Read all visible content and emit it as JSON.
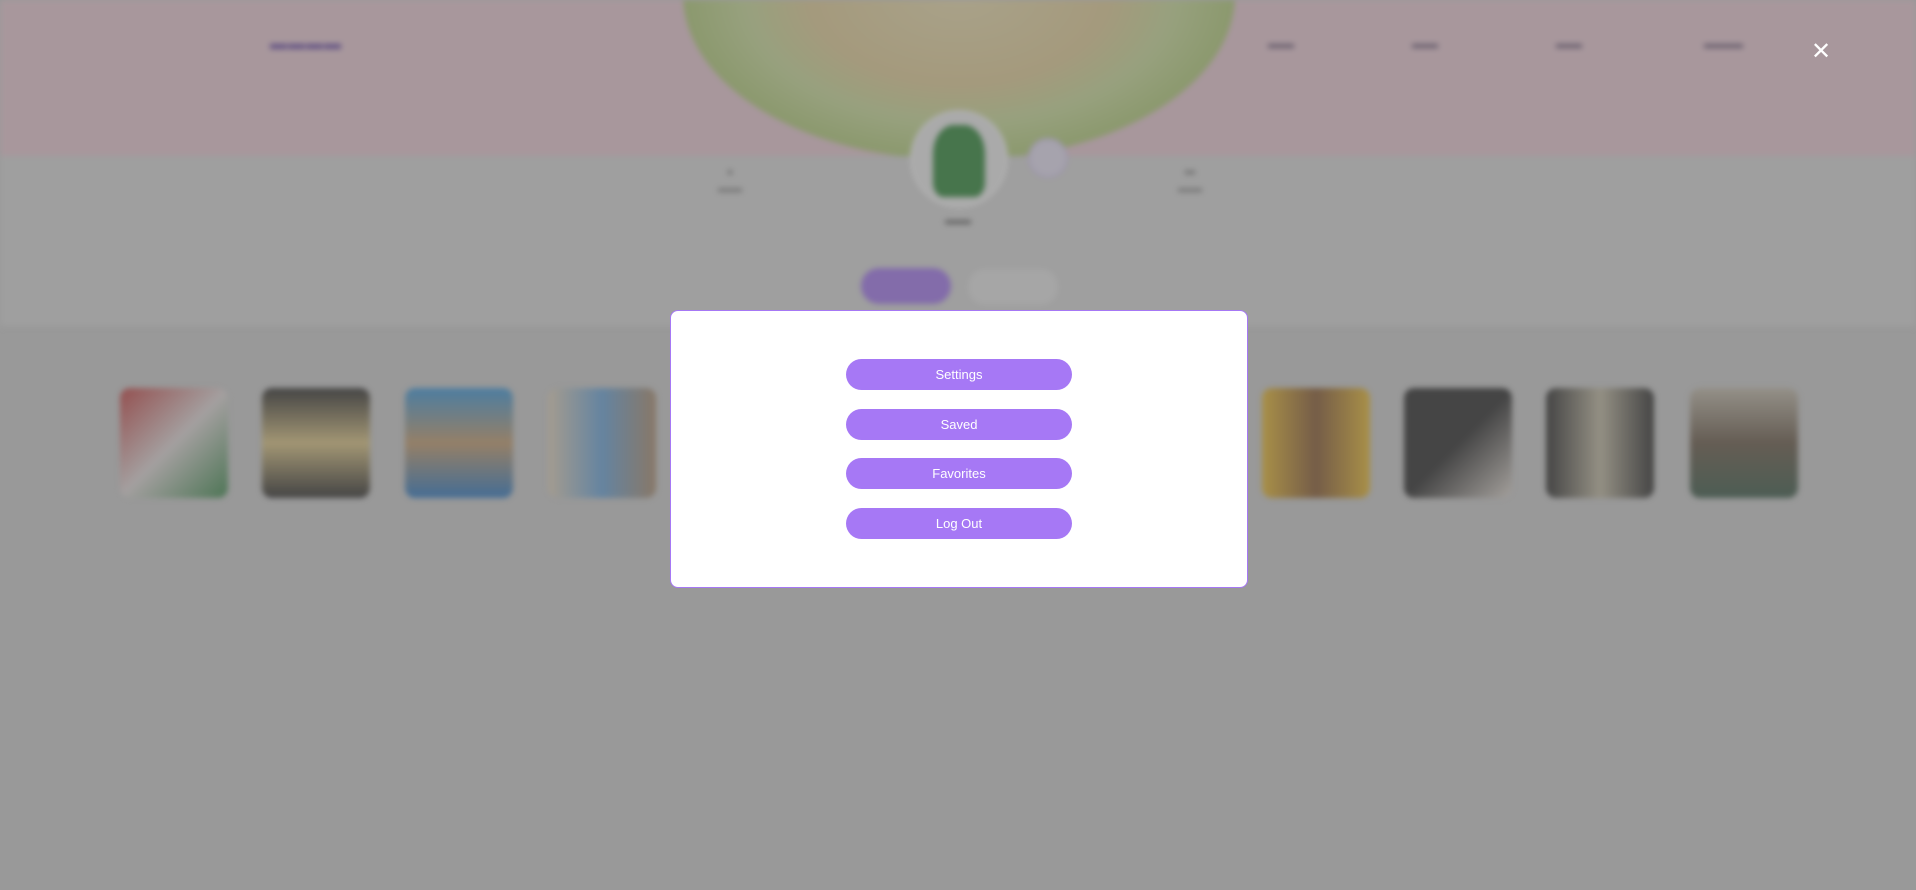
{
  "modal": {
    "buttons": [
      {
        "label": "Settings"
      },
      {
        "label": "Saved"
      },
      {
        "label": "Favorites"
      },
      {
        "label": "Log Out"
      }
    ]
  },
  "close": {
    "icon": "close-icon",
    "glyph": "✕"
  },
  "colors": {
    "accent": "#a678f5",
    "hero_background": "#f0cfd9",
    "overlay": "rgba(96,96,96,0.5)"
  }
}
